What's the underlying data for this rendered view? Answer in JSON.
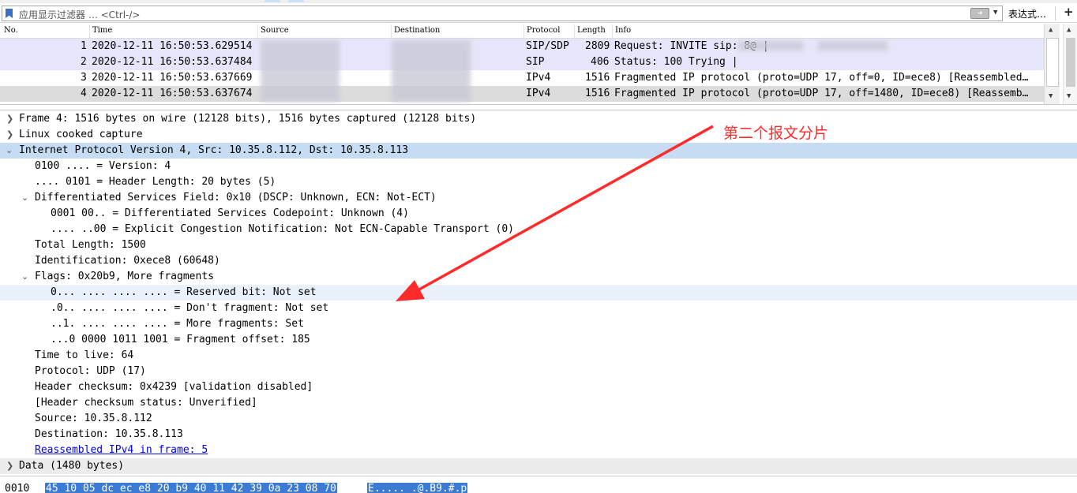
{
  "filter": {
    "placeholder": "应用显示过滤器 … <Ctrl-/>",
    "expression_label": "表达式…",
    "add_label": "+"
  },
  "packet_list": {
    "columns": [
      "No.",
      "Time",
      "Source",
      "Destination",
      "Protocol",
      "Length",
      "Info"
    ],
    "rows": [
      {
        "no": "1",
        "time": "2020-12-11 16:50:53.629514",
        "protocol": "SIP/SDP",
        "length": "2809",
        "info": "Request: INVITE sip:              8@              |"
      },
      {
        "no": "2",
        "time": "2020-12-11 16:50:53.637484",
        "protocol": "SIP",
        "length": "406",
        "info": "Status: 100 Trying |"
      },
      {
        "no": "3",
        "time": "2020-12-11 16:50:53.637669",
        "protocol": "IPv4",
        "length": "1516",
        "info": "Fragmented IP protocol (proto=UDP 17, off=0, ID=ece8) [Reassembled…"
      },
      {
        "no": "4",
        "time": "2020-12-11 16:50:53.637674",
        "protocol": "IPv4",
        "length": "1516",
        "info": "Fragmented IP protocol (proto=UDP 17, off=1480, ID=ece8) [Reassemb…"
      }
    ]
  },
  "details": {
    "frame": "Frame 4: 1516 bytes on wire (12128 bits), 1516 bytes captured (12128 bits)",
    "linux": "Linux cooked capture",
    "ip": "Internet Protocol Version 4, Src: 10.35.8.112, Dst: 10.35.8.113",
    "version": "0100 .... = Version: 4",
    "hdrlen": ".... 0101 = Header Length: 20 bytes (5)",
    "dsfield": "Differentiated Services Field: 0x10 (DSCP: Unknown, ECN: Not-ECT)",
    "dscp": "0001 00.. = Differentiated Services Codepoint: Unknown (4)",
    "ecn": ".... ..00 = Explicit Congestion Notification: Not ECN-Capable Transport (0)",
    "total_length": "Total Length: 1500",
    "identification": "Identification: 0xece8 (60648)",
    "flags": "Flags: 0x20b9, More fragments",
    "reserved": "0... .... .... .... = Reserved bit: Not set",
    "dont_frag": ".0.. .... .... .... = Don't fragment: Not set",
    "more_frag": "..1. .... .... .... = More fragments: Set",
    "frag_offset": "...0 0000 1011 1001 = Fragment offset: 185",
    "ttl": "Time to live: 64",
    "protocol": "Protocol: UDP (17)",
    "checksum": "Header checksum: 0x4239 [validation disabled]",
    "checksum_status": "[Header checksum status: Unverified]",
    "source": "Source: 10.35.8.112",
    "destination": "Destination: 10.35.8.113",
    "reassembled": "Reassembled IPv4 in frame: 5",
    "data": "Data (1480 bytes)"
  },
  "annotation": "第二个报文分片",
  "hex": {
    "offset": "0010",
    "bytes": "45 10 05 dc ec e8 20 b9  40 11 42 39 0a 23 08 70",
    "ascii": "E.....  .@.B9.#.p"
  },
  "colors": {
    "sip_row": "#e6e6fa",
    "selected_row": "#dcdcdc",
    "highlight_row": "#c6dcf3",
    "annotation": "#ff2a2a",
    "hex_select": "#3b7bd4"
  }
}
